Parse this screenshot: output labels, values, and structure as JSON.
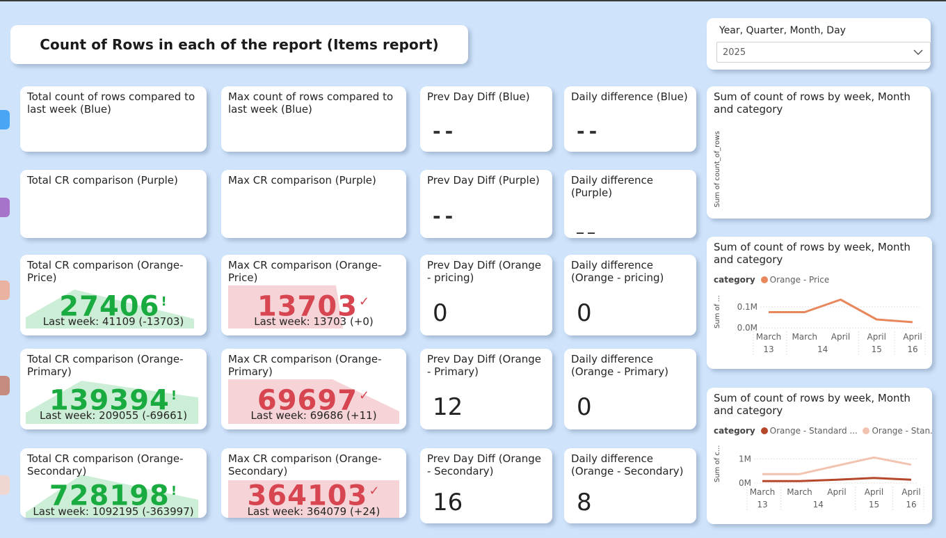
{
  "header": {
    "title": "Count of Rows in each of the report (Items report)"
  },
  "slicer": {
    "label": "Year, Quarter, Month, Day",
    "value": "2025",
    "icon": "chevron-down-icon"
  },
  "colors": {
    "tab_blue": "#4aa6f5",
    "tab_purple": "#a774cc",
    "tab_orange_price": "#e9b2a1",
    "tab_orange_primary": "#c58b7e",
    "tab_orange_secondary": "#efd6d1",
    "kpi_good": "#1aab40",
    "kpi_bad": "#d64550",
    "spark_green": "#cdeed6",
    "spark_red": "#f6d3d6"
  },
  "row_blue": {
    "total": {
      "title": "Total count of rows compared to last week (Blue)"
    },
    "max": {
      "title": "Max count of rows compared to last week (Blue)"
    },
    "prev": {
      "title": "Prev Day Diff (Blue)",
      "value": "--"
    },
    "daily": {
      "title": "Daily difference (Blue)",
      "value": "--"
    }
  },
  "row_purple": {
    "total": {
      "title": "Total CR comparison (Purple)"
    },
    "max": {
      "title": "Max CR comparison (Purple)"
    },
    "prev": {
      "title": "Prev Day Diff (Purple)",
      "value": "--"
    },
    "daily": {
      "title": "Daily difference (Purple)",
      "value": "__"
    }
  },
  "row_price": {
    "total": {
      "title": "Total CR comparison (Orange-Price)",
      "value": "27406",
      "mark": "!",
      "sub": "Last week: 41109 (-13703)"
    },
    "max": {
      "title": "Max CR comparison (Orange-Price)",
      "value": "13703",
      "mark": "✓",
      "sub": "Last week: 13703 (+0)"
    },
    "prev": {
      "title": "Prev Day Diff (Orange - pricing)",
      "value": "0"
    },
    "daily": {
      "title": "Daily difference (Orange - pricing)",
      "value": "0"
    }
  },
  "row_primary": {
    "total": {
      "title": "Total CR comparison (Orange-Primary)",
      "value": "139394",
      "mark": "!",
      "sub": "Last week: 209055 (-69661)"
    },
    "max": {
      "title": "Max CR comparison (Orange-Primary)",
      "value": "69697",
      "mark": "✓",
      "sub": "Last week: 69686 (+11)"
    },
    "prev": {
      "title": "Prev Day Diff (Orange - Primary)",
      "value": "12"
    },
    "daily": {
      "title": "Daily difference (Orange - Primary)",
      "value": "0"
    }
  },
  "row_secondary": {
    "total": {
      "title": "Total CR comparison (Orange-Secondary)",
      "value": "728198",
      "mark": "!",
      "sub": "Last week: 1092195 (-363997)"
    },
    "max": {
      "title": "Max CR comparison (Orange-Secondary)",
      "value": "364103",
      "mark": "✓",
      "sub": "Last week: 364079 (+24)"
    },
    "prev": {
      "title": "Prev Day Diff (Orange - Secondary)",
      "value": "16"
    },
    "daily": {
      "title": "Daily difference (Orange - Secondary)",
      "value": "8"
    }
  },
  "charts": {
    "c1": {
      "title": "Sum of count of rows by week, Month and category",
      "ylabel": "Sum of count_of_rows"
    },
    "c2": {
      "title": "Sum of count of rows by week, Month and category",
      "legend_title": "category",
      "ylabel": "Sum of ..."
    },
    "c3": {
      "title": "Sum of count of rows by week, Month and category",
      "legend_title": "category",
      "ylabel": "Sum of c..."
    }
  },
  "chart_data": [
    {
      "type": "line",
      "title": "Sum of count of rows by week, Month and category",
      "ylabel": "Sum of count_of_rows",
      "series": []
    },
    {
      "type": "line",
      "title": "Sum of count of rows by week, Month and category",
      "ylabel": "Sum of ...",
      "legend_title": "category",
      "x": [
        {
          "month": "March",
          "week": "13"
        },
        {
          "month": "March",
          "week": "14"
        },
        {
          "month": "April",
          "week": "14"
        },
        {
          "month": "April",
          "week": "15"
        },
        {
          "month": "April",
          "week": "16"
        }
      ],
      "x_groups": [
        "13",
        "14",
        "15",
        "16"
      ],
      "yticks": [
        "0.1M",
        "0.0M"
      ],
      "ytick_values": [
        100000,
        0
      ],
      "ylim": [
        0,
        150000
      ],
      "series": [
        {
          "name": "Orange - Price",
          "color": "#e8875c",
          "values": [
            75000,
            75000,
            135000,
            40000,
            27000
          ]
        }
      ]
    },
    {
      "type": "line",
      "title": "Sum of count of rows by week, Month and category",
      "ylabel": "Sum of c...",
      "legend_title": "category",
      "x": [
        {
          "month": "March",
          "week": "13"
        },
        {
          "month": "March",
          "week": "14"
        },
        {
          "month": "April",
          "week": "14"
        },
        {
          "month": "April",
          "week": "15"
        },
        {
          "month": "April",
          "week": "16"
        }
      ],
      "x_groups": [
        "13",
        "14",
        "15",
        "16"
      ],
      "yticks": [
        "1M",
        "0M"
      ],
      "ytick_values": [
        1000000,
        0
      ],
      "ylim": [
        0,
        1300000
      ],
      "series": [
        {
          "name": "Orange - Standard ...",
          "color": "#b5482a",
          "values": [
            80000,
            80000,
            140000,
            210000,
            140000
          ]
        },
        {
          "name": "Orange - Stan...",
          "color": "#f2c3b1",
          "values": [
            370000,
            370000,
            720000,
            1060000,
            760000
          ]
        }
      ]
    }
  ]
}
